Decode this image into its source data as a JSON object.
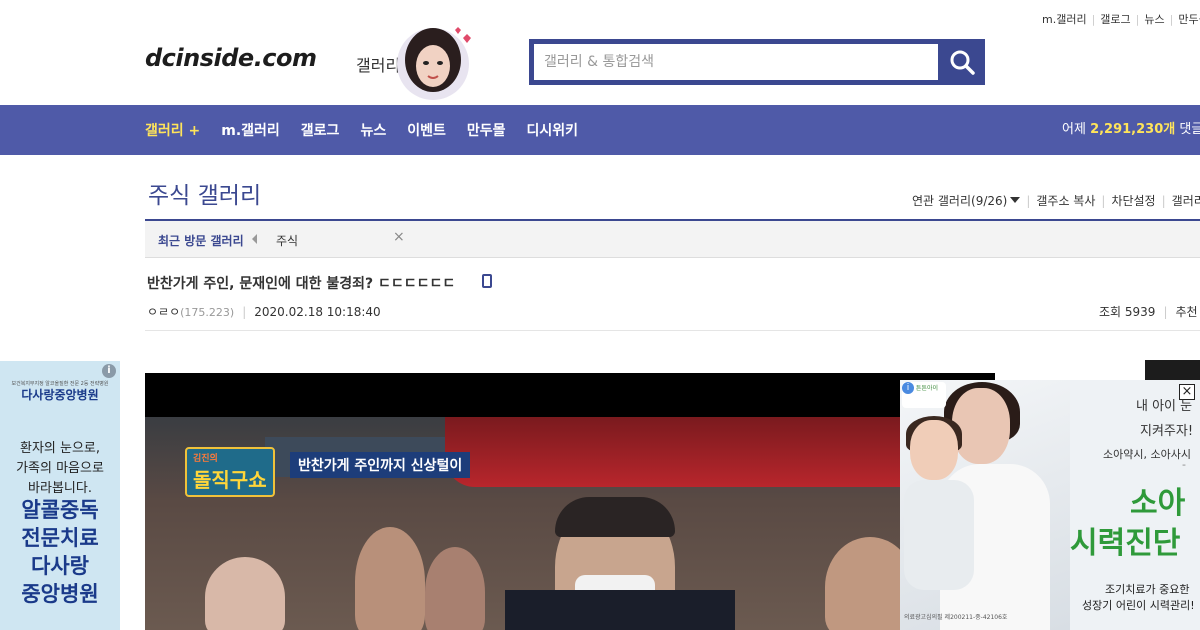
{
  "top_links": [
    "m.갤러리",
    "갤로그",
    "뉴스",
    "만두몰"
  ],
  "logo": {
    "text": "dcinside.com",
    "sub": "갤러리"
  },
  "search": {
    "placeholder": "갤러리 & 통합검색"
  },
  "nav": {
    "items": [
      "갤러리 +",
      "m.갤러리",
      "갤로그",
      "뉴스",
      "이벤트",
      "만두몰",
      "디시위키"
    ],
    "stats_prefix": "어제",
    "stats_value": "2,291,230개",
    "stats_suffix": "댓글"
  },
  "gallery": {
    "title": "주식 갤러리",
    "tools": [
      "연관 갤러리(9/26)",
      "갤주소 복사",
      "차단설정",
      "갤러리"
    ]
  },
  "recent": {
    "label": "최근 방문 갤러리",
    "item": "주식",
    "close": "×"
  },
  "post": {
    "title": "반찬가게 주인, 문재인에 대한 불경죄? ㄷㄷㄷㄷㄷㄷ",
    "author": "ㅇㄹㅇ",
    "ip": "(175.223)",
    "date": "2020.02.18 10:18:40",
    "views_label": "조회 5939",
    "recommend_label": "추천"
  },
  "video": {
    "logo": "돌직구쇼",
    "logo_small": "김진의",
    "caption": "반찬가게 주인까지 신상털이"
  },
  "left_ad": {
    "info": "i",
    "tiny": "보건복지부지정 알코올질환 전문 2등 전략병원",
    "brand": "다사랑중앙병원",
    "copy": [
      "환자의 눈으로,",
      "가족의 마음으로",
      "바라봅니다."
    ],
    "big": [
      "알콜중독",
      "전문치료",
      "다사랑",
      "중앙병원"
    ]
  },
  "right_ad": {
    "close": "×",
    "badge": "튼튼아이",
    "hand1": "내 아이 눈",
    "hand2": "지켜주자!",
    "sub": "소아약시, 소아사시",
    "dash": "-",
    "big1": "소아",
    "big2": "시력진단",
    "note1": "조기치료가 중요한",
    "note2": "성장기 어린이 시력관리!",
    "fine": "의료광고심의필 제200211-중-42106호"
  }
}
